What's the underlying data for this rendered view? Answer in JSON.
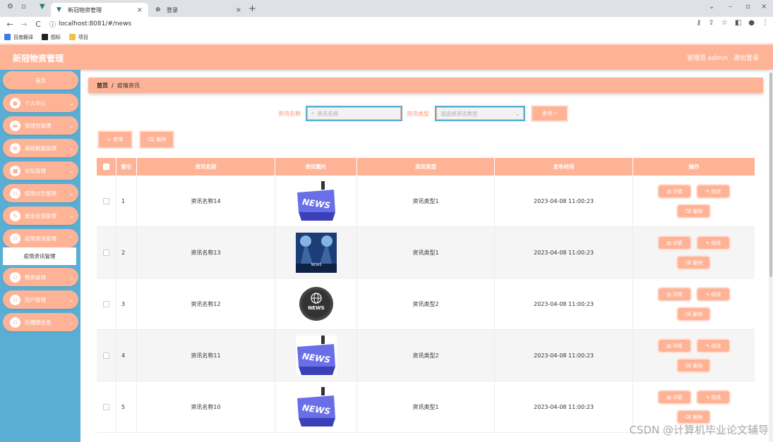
{
  "browser": {
    "tabs": [
      {
        "label": "新冠物资管理",
        "active": true
      },
      {
        "label": "登录",
        "active": false
      }
    ],
    "url": "localhost:8081/#/news",
    "bookmarks": [
      "百度翻译",
      "图标",
      "项目"
    ]
  },
  "header": {
    "title": "新冠物资管理",
    "user": "管理员 admin",
    "logout": "退出登录"
  },
  "sidebar": {
    "items": [
      {
        "label": "首页",
        "icon": "home"
      },
      {
        "label": "个人中心",
        "icon": "user-icon"
      },
      {
        "label": "管理员管理",
        "icon": "admin-icon"
      },
      {
        "label": "基础数据管理",
        "icon": "list-icon"
      },
      {
        "label": "论坛管理",
        "icon": "forum-icon"
      },
      {
        "label": "疫情公告管理",
        "icon": "grid-icon"
      },
      {
        "label": "留言反馈管理",
        "icon": "feedback-icon"
      },
      {
        "label": "疫情资讯管理",
        "icon": "grid-icon"
      },
      {
        "label": "物资管理",
        "icon": "grid-icon"
      },
      {
        "label": "用户管理",
        "icon": "grid-icon"
      },
      {
        "label": "轮播图信息",
        "icon": "grid-icon"
      }
    ],
    "sub_item": "疫情资讯管理"
  },
  "breadcrumb": {
    "home": "首页",
    "sep": "/",
    "current": "疫情资讯"
  },
  "search": {
    "name_label": "资讯名称",
    "name_placeholder": "资讯名称",
    "type_label": "资讯类型",
    "type_placeholder": "请选择资讯类型",
    "query_button": "查询"
  },
  "actions": {
    "add": "新增",
    "delete": "删除"
  },
  "table": {
    "headers": [
      "",
      "索引",
      "资讯名称",
      "资讯图片",
      "资讯类型",
      "发布时间",
      "操作"
    ],
    "rows": [
      {
        "index": "1",
        "name": "资讯名称14",
        "image": "news-3d",
        "type": "资讯类型1",
        "time": "2023-04-08 11:00:23"
      },
      {
        "index": "2",
        "name": "资讯名称13",
        "image": "news-stage",
        "type": "资讯类型1",
        "time": "2023-04-08 11:00:23"
      },
      {
        "index": "3",
        "name": "资讯名称12",
        "image": "news-globe",
        "type": "资讯类型2",
        "time": "2023-04-08 11:00:23"
      },
      {
        "index": "4",
        "name": "资讯名称11",
        "image": "news-3d",
        "type": "资讯类型2",
        "time": "2023-04-08 11:00:23"
      },
      {
        "index": "5",
        "name": "资讯名称10",
        "image": "news-3d",
        "type": "资讯类型1",
        "time": "2023-04-08 11:00:23"
      }
    ],
    "row_buttons": {
      "detail": "详情",
      "edit": "修改",
      "delete": "删除"
    }
  },
  "watermark": "CSDN @计算机毕业论文辅导",
  "colors": {
    "accent": "#ffb396",
    "sidebar": "#5aaed3",
    "label": "#ff9270"
  }
}
